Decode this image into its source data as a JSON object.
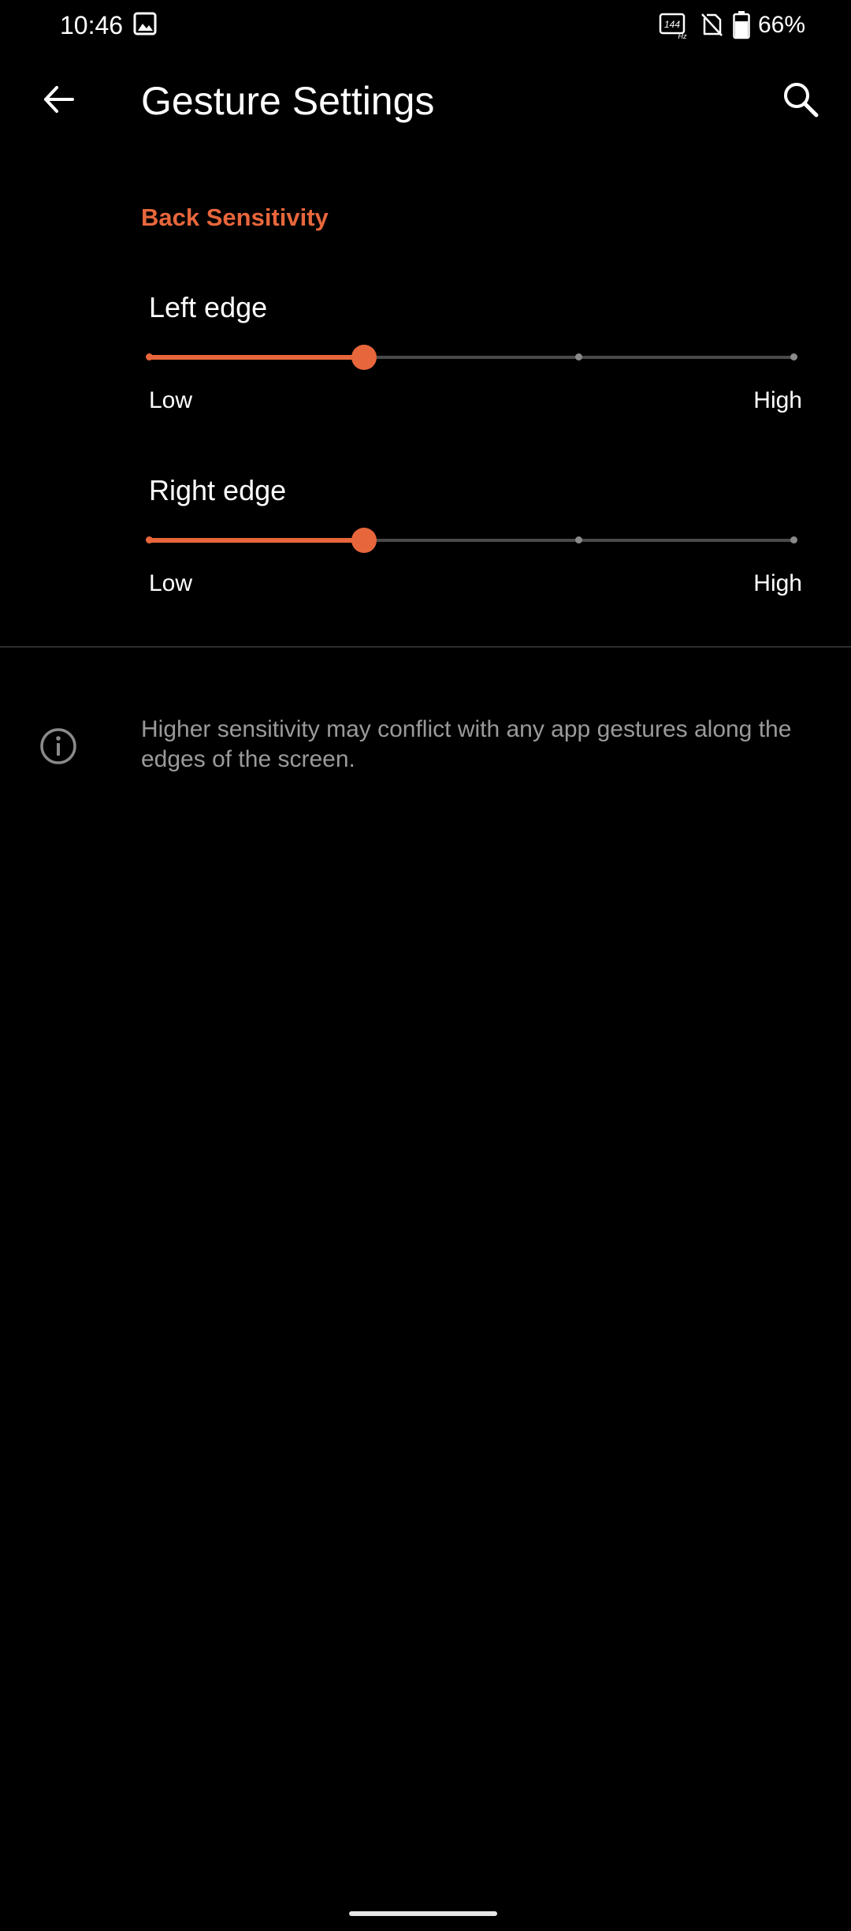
{
  "status_bar": {
    "time": "10:46",
    "battery": "66%",
    "icons": [
      "gallery-icon",
      "refresh-rate-144hz-icon",
      "no-sim-icon",
      "battery-icon"
    ]
  },
  "app_bar": {
    "title": "Gesture Settings",
    "back_icon": "arrow-back-icon",
    "search_icon": "search-icon"
  },
  "section": {
    "title": "Back Sensitivity"
  },
  "sliders": [
    {
      "label": "Left edge",
      "low_label": "Low",
      "high_label": "High",
      "steps": 4,
      "selected_index": 1
    },
    {
      "label": "Right edge",
      "low_label": "Low",
      "high_label": "High",
      "steps": 4,
      "selected_index": 1
    }
  ],
  "info": {
    "icon": "info-icon",
    "text": "Higher sensitivity may conflict with any app gestures along the edges of the screen."
  },
  "colors": {
    "accent": "#e8663c",
    "background": "#000000",
    "track": "#4a4a4a",
    "secondary_text": "#9a9a9a"
  }
}
